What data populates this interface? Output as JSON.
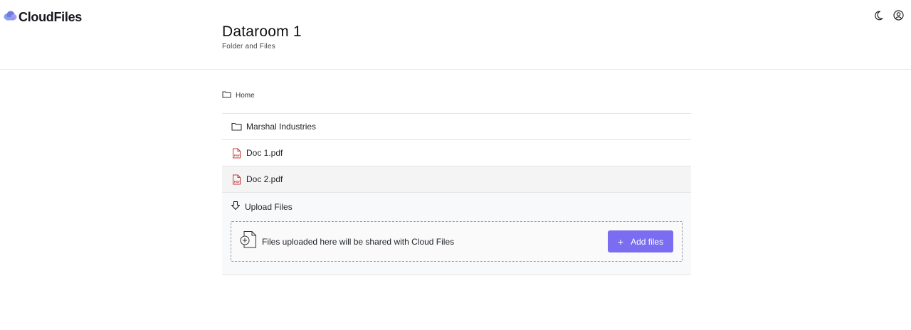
{
  "brand": {
    "name": "CloudFiles",
    "accent": "#7b6df2"
  },
  "header": {
    "title": "Dataroom 1",
    "subtitle": "Folder and Files"
  },
  "top_icons": [
    "moon-icon",
    "user-circle-icon"
  ],
  "breadcrumb": {
    "label": "Home"
  },
  "items": [
    {
      "type": "folder",
      "label": "Marshal Industries"
    },
    {
      "type": "pdf",
      "label": "Doc 1.pdf"
    },
    {
      "type": "pdf",
      "label": "Doc 2.pdf"
    }
  ],
  "upload": {
    "title": "Upload Files",
    "hint": "Files uploaded here will be shared with Cloud Files",
    "button_label": "Add files"
  }
}
